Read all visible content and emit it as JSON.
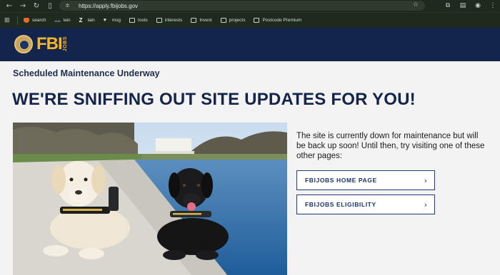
{
  "browser": {
    "url": "https://apply.fbijobs.gov",
    "bookmarks": [
      {
        "label": "search",
        "icon": "brave-icon"
      },
      {
        "label": "lain",
        "icon": "bird-icon"
      },
      {
        "label": "lain",
        "icon": "z-icon"
      },
      {
        "label": "msg",
        "icon": "heart-icon"
      },
      {
        "label": "tools",
        "icon": "folder-icon"
      },
      {
        "label": "interests",
        "icon": "folder-icon"
      },
      {
        "label": "Invest",
        "icon": "folder-icon"
      },
      {
        "label": "projects",
        "icon": "folder-icon"
      },
      {
        "label": "Postcode Premium",
        "icon": "folder-icon"
      }
    ]
  },
  "header": {
    "logo_text": "FBI",
    "logo_sub": "JOBS",
    "colors": {
      "navy": "#13254a",
      "gold": "#f5b52e"
    }
  },
  "main": {
    "kicker": "Scheduled Maintenance Underway",
    "headline": "WE'RE SNIFFING OUT SITE UPDATES FOR YOU!",
    "message": "The site is currently down for maintenance but will be back up soon! Until then, try visiting one of these other pages:",
    "links": [
      {
        "label": "FBIJOBS HOME PAGE"
      },
      {
        "label": "FBIJOBS ELIGIBILITY"
      }
    ]
  }
}
